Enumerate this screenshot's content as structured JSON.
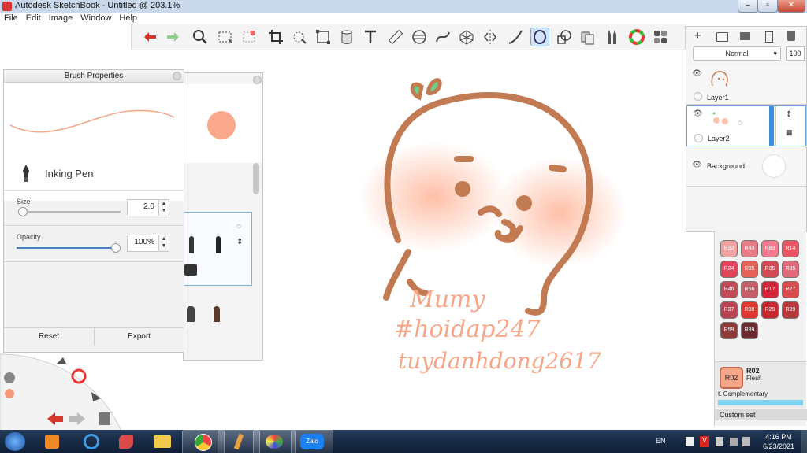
{
  "window": {
    "title": "Autodesk SketchBook - Untitled @ 203.1%",
    "controls": [
      "–",
      "▫",
      "✕"
    ]
  },
  "menu": [
    "File",
    "Edit",
    "Image",
    "Window",
    "Help"
  ],
  "toolbar": {
    "tools": [
      "undo-icon",
      "redo-icon",
      "zoom-icon",
      "select-rect-icon",
      "select-lasso-icon",
      "crop-icon",
      "magic-wand-icon",
      "transform-icon",
      "fill-bucket-icon",
      "text-icon",
      "ruler-icon",
      "ellipse-guide-icon",
      "french-curve-icon",
      "perspective-icon",
      "symmetry-icon",
      "stroke-icon",
      "predictive-stroke-icon",
      "shapes-icon",
      "copy-paste-icon",
      "brushes-icon",
      "color-wheel-icon",
      "swatches-icon"
    ],
    "active_tool": "predictive-stroke-icon"
  },
  "brush_properties": {
    "title": "Brush Properties",
    "brush_name": "Inking Pen",
    "size_label": "Size",
    "size_value": "2.0",
    "opacity_label": "Opacity",
    "opacity_value": "100%",
    "opacity_fraction": 1.0,
    "size_fraction": 0.0,
    "reset_label": "Reset",
    "export_label": "Export",
    "stroke_color": "#f4a98a"
  },
  "brush_library": {
    "current_color": "#f9a88b"
  },
  "layers": {
    "blend_mode": "Normal",
    "opacity": "100",
    "items": [
      {
        "name": "Layer1"
      },
      {
        "name": "Layer2"
      },
      {
        "name": "Background"
      }
    ]
  },
  "swatches": {
    "rows": [
      [
        "R32",
        "R43",
        "R83",
        "R14"
      ],
      [
        "R24",
        "R05",
        "R35",
        "R85"
      ],
      [
        "R46",
        "R56",
        "R17",
        "R27"
      ],
      [
        "R37",
        "R08",
        "R29",
        "R39"
      ],
      [
        "R59",
        "R89"
      ]
    ],
    "colors": {
      "R32": "#f0a3a3",
      "R43": "#e97b86",
      "R83": "#f07c8d",
      "R14": "#ea5563",
      "R24": "#e2455a",
      "R05": "#e86157",
      "R35": "#d24a54",
      "R85": "#e06a7a",
      "R46": "#c04a55",
      "R56": "#c65e6a",
      "R17": "#d3263a",
      "R27": "#d94d4d",
      "R37": "#bb4452",
      "R08": "#e0382e",
      "R29": "#c9272f",
      "R39": "#b8383c",
      "R59": "#8e3a3b",
      "R89": "#6e2a31"
    },
    "selected_code": "R02",
    "selected_name": "Flesh",
    "selected_color": "#f7a688",
    "complementary_label": "Complementary",
    "custom_set_label": "Custom set"
  },
  "canvas": {
    "handwriting": [
      "Mumy",
      "#hoidap247",
      "tuydanhdong2617"
    ]
  },
  "taskbar": {
    "apps": [
      "windows-start-icon",
      "media-player-icon",
      "internet-explorer-icon",
      "paint-tool-icon",
      "file-explorer-icon",
      "chrome-icon",
      "sketchbook-icon",
      "paint-icon",
      "zalo-icon"
    ],
    "zalo_label": "Zalo",
    "language": "EN",
    "time": "4:16 PM",
    "date": "6/23/2021"
  }
}
